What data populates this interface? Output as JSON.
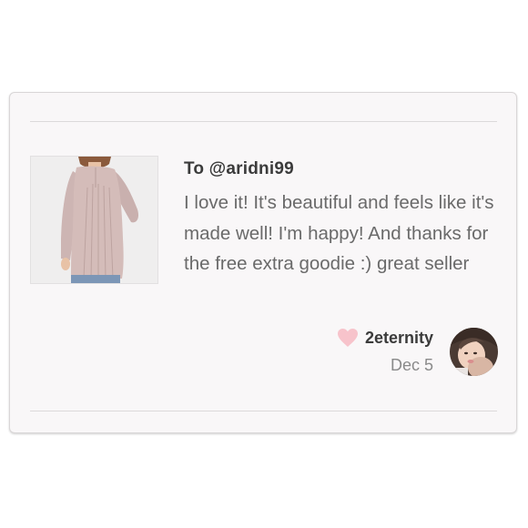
{
  "review": {
    "to_label": "To @aridni99",
    "text": "I love it! It's beautiful and feels like it's made well! I'm happy! And thanks for the free extra goodie :) great seller"
  },
  "reviewer": {
    "username": "2eternity",
    "date": "Dec 5",
    "heart_icon": "heart-icon",
    "heart_color": "#f7c3cb"
  },
  "product": {
    "image": "product-image-blouse"
  },
  "colors": {
    "card_background": "#f9f7f8",
    "divider": "#dcd9da",
    "text_dark": "#3b3b3b",
    "text_body": "#6a6a6a",
    "text_muted": "#8a8a8a"
  }
}
